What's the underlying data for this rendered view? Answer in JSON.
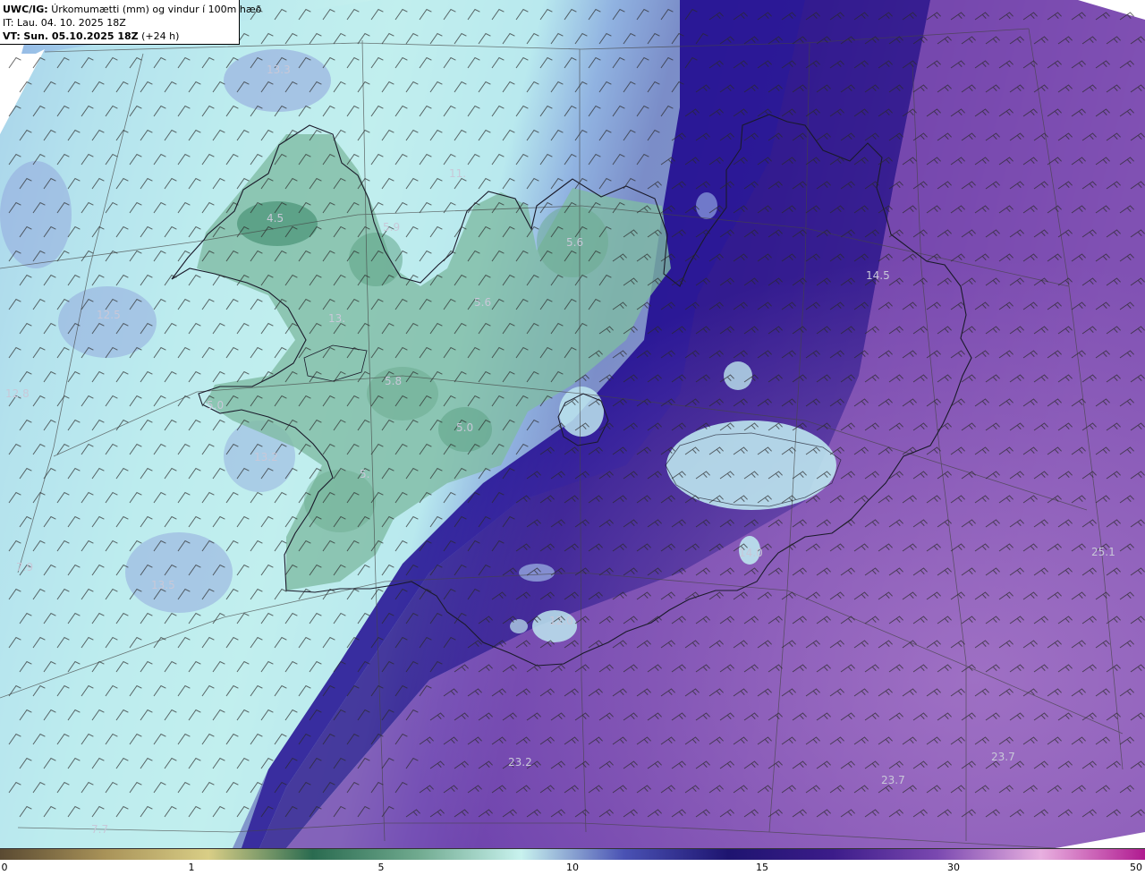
{
  "header": {
    "model": "UWC/IG:",
    "description": "Úrkomumætti (mm) og vindur í 100m hæð",
    "it_label": "IT:",
    "it_value": "Lau. 04. 10. 2025 18Z",
    "vt_label": "VT:",
    "vt_value": "Sun. 05.10.2025 18Z",
    "vt_suffix": "(+24 h)"
  },
  "value_labels": [
    "13.3",
    "11.",
    "4.5",
    "5.9",
    "5.6",
    "14.5",
    "12.5",
    "13.",
    "5.6",
    "12.8",
    "5.8",
    "5.0",
    "5.0",
    "13.2",
    "5.",
    "7.9",
    "13.5",
    "14.0",
    "12.0",
    "25.1",
    "23.2",
    "23.7",
    "23.7",
    "7.7"
  ],
  "colorbar": {
    "ticks": [
      "0",
      "1",
      "5",
      "10",
      "15",
      "30",
      "50"
    ],
    "colors": [
      "#5a4a32",
      "#a89258",
      "#d9ce86",
      "#2a6b50",
      "#6fa98e",
      "#c8f2ee",
      "#4a52b4",
      "#1e1470",
      "#3c1c8a",
      "#7a48b0",
      "#e8b0e0",
      "#b01a90"
    ]
  },
  "map_colors": {
    "light_band": "#b9e8ee",
    "green_land": "#86c2a8",
    "deep_blue": "#24138c",
    "purple_sea": "#8758b8",
    "frame_white": "#ffffff"
  }
}
